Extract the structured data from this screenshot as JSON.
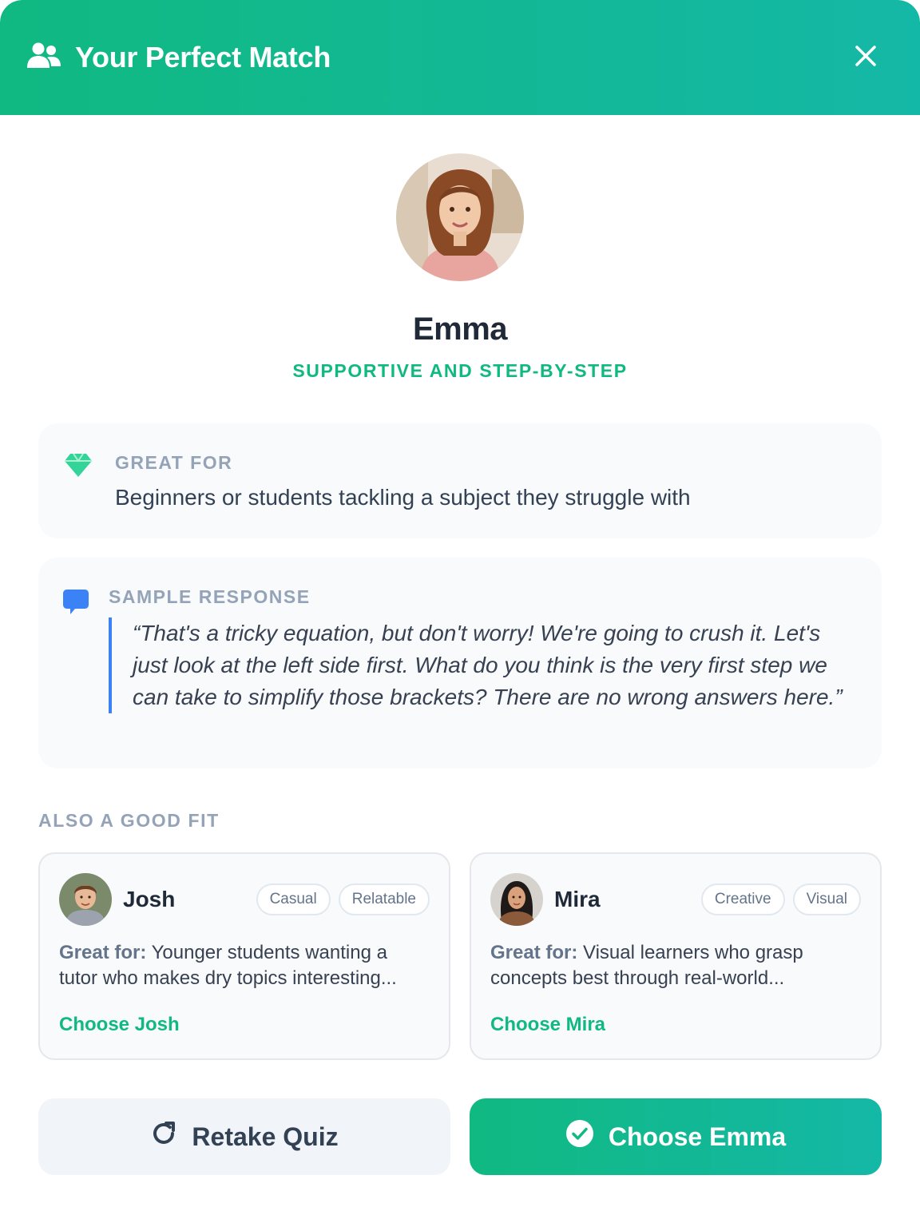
{
  "header": {
    "title": "Your Perfect Match",
    "icon": "users-icon",
    "close_icon": "close-icon"
  },
  "match": {
    "name": "Emma",
    "style": "SUPPORTIVE AND STEP-BY-STEP",
    "great_for_label": "GREAT FOR",
    "great_for_text": "Beginners or students tackling a subject they struggle with",
    "sample_label": "SAMPLE RESPONSE",
    "sample_text": "“That's a tricky equation, but don't worry! We're going to crush it. Let's just look at the left side first. What do you think is the very first step we can take to simplify those brackets? There are no wrong answers here.”"
  },
  "also": {
    "label": "ALSO A GOOD FIT",
    "tutors": [
      {
        "name": "Josh",
        "tags": [
          "Casual",
          "Relatable"
        ],
        "great_for_prefix": "Great for:",
        "great_for_text": " Younger students wanting a tutor who makes dry topics interesting...",
        "choose_label": "Choose Josh"
      },
      {
        "name": "Mira",
        "tags": [
          "Creative",
          "Visual"
        ],
        "great_for_prefix": "Great for:",
        "great_for_text": " Visual learners who grasp concepts best through real-world...",
        "choose_label": "Choose Mira"
      }
    ]
  },
  "actions": {
    "retake_label": "Retake Quiz",
    "choose_label": "Choose Emma"
  },
  "colors": {
    "brand_green": "#10b981",
    "brand_teal": "#14b8a6",
    "quote_border": "#3b82f6",
    "muted_label": "#94a3b8"
  }
}
